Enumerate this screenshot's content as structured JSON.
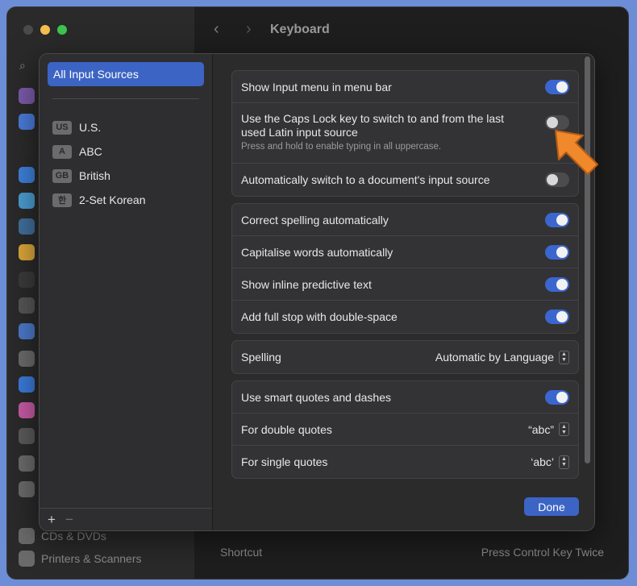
{
  "window": {
    "title": "Keyboard",
    "back_glyph": "‹",
    "forward_glyph": "›",
    "background_sidebar_items": [
      "CDs & DVDs",
      "Printers & Scanners"
    ],
    "background_row": {
      "label": "Shortcut",
      "value": "Press Control Key Twice"
    }
  },
  "sheet": {
    "sidebar": {
      "selected": "All Input Sources",
      "sources": [
        {
          "badge": "US",
          "label": "U.S."
        },
        {
          "badge": "A",
          "label": "ABC"
        },
        {
          "badge": "GB",
          "label": "British"
        },
        {
          "badge": "한",
          "label": "2-Set Korean"
        }
      ],
      "add_label": "+",
      "remove_label": "−"
    },
    "group1": {
      "show_input_menu": {
        "label": "Show Input menu in menu bar",
        "on": true
      },
      "caps_lock": {
        "label": "Use the Caps Lock key to switch to and from the last used Latin input source",
        "sub": "Press and hold to enable typing in all uppercase.",
        "on": false
      },
      "auto_switch": {
        "label": "Automatically switch to a document's input source",
        "on": false
      }
    },
    "group2": {
      "correct_spelling": {
        "label": "Correct spelling automatically",
        "on": true
      },
      "capitalise": {
        "label": "Capitalise words automatically",
        "on": true
      },
      "predictive": {
        "label": "Show inline predictive text",
        "on": true
      },
      "full_stop": {
        "label": "Add full stop with double-space",
        "on": true
      }
    },
    "spelling": {
      "label": "Spelling",
      "value": "Automatic by Language"
    },
    "group4": {
      "smart_quotes": {
        "label": "Use smart quotes and dashes",
        "on": true
      },
      "double_quotes": {
        "label": "For double quotes",
        "value": "“abc”"
      },
      "single_quotes": {
        "label": "For single quotes",
        "value": "‘abc’"
      }
    },
    "done_label": "Done"
  },
  "colors": {
    "accent": "#3c64c4",
    "toggle_on": "#3b66cf",
    "arrow": "#f0892c"
  }
}
